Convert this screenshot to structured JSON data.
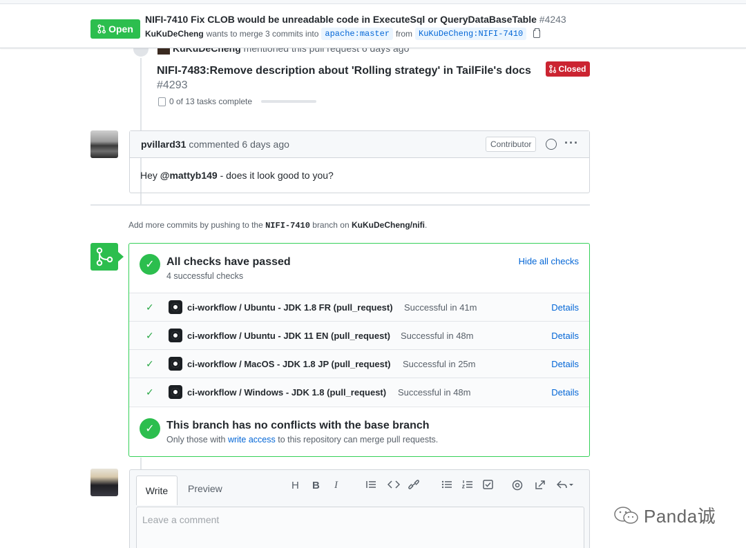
{
  "header": {
    "state_label": "Open",
    "title": "NIFI-7410 Fix CLOB would be unreadable code in ExecuteSql or QueryDataBaseTable",
    "number": "#4243",
    "author": "KuKuDeCheng",
    "merge_text": "wants to merge 3 commits into",
    "base_branch": "apache:master",
    "from_text": "from",
    "head_branch": "KuKuDeCheng:NIFI-7410"
  },
  "mention": {
    "author": "KuKuDeCheng",
    "text": "mentioned this pull request 6 days ago",
    "ref_title": "NIFI-7483:Remove description about 'Rolling strategy' in TailFile's docs",
    "ref_number": "#4293",
    "ref_state": "Closed",
    "tasks": "0 of 13 tasks complete"
  },
  "comment": {
    "author": "pvillard31",
    "action": "commented 6 days ago",
    "role": "Contributor",
    "body_prefix": "Hey",
    "body_mention": "@mattyb149",
    "body_suffix": "- does it look good to you?"
  },
  "add_more": {
    "prefix": "Add more commits by pushing to the",
    "branch": "NIFI-7410",
    "middle": "branch on",
    "repo": "KuKuDeCheng/nifi",
    "suffix": "."
  },
  "checks": {
    "title": "All checks have passed",
    "subtitle": "4 successful checks",
    "hide_label": "Hide all checks",
    "items": [
      {
        "name": "ci-workflow / Ubuntu - JDK 1.8 FR (pull_request)",
        "status": "Successful in 41m",
        "details": "Details"
      },
      {
        "name": "ci-workflow / Ubuntu - JDK 11 EN (pull_request)",
        "status": "Successful in 48m",
        "details": "Details"
      },
      {
        "name": "ci-workflow / MacOS - JDK 1.8 JP (pull_request)",
        "status": "Successful in 25m",
        "details": "Details"
      },
      {
        "name": "ci-workflow / Windows - JDK 1.8 (pull_request)",
        "status": "Successful in 48m",
        "details": "Details"
      }
    ],
    "conflict_title": "This branch has no conflicts with the base branch",
    "conflict_prefix": "Only those with",
    "conflict_link": "write access",
    "conflict_suffix": "to this repository can merge pull requests."
  },
  "composer": {
    "tab_write": "Write",
    "tab_preview": "Preview",
    "placeholder": "Leave a comment",
    "toolbar": [
      "H",
      "B",
      "I"
    ]
  },
  "watermark": "Panda诚",
  "colors": {
    "open_green": "#2cbe4e",
    "closed_red": "#cb2431",
    "link_blue": "#0366d6"
  }
}
